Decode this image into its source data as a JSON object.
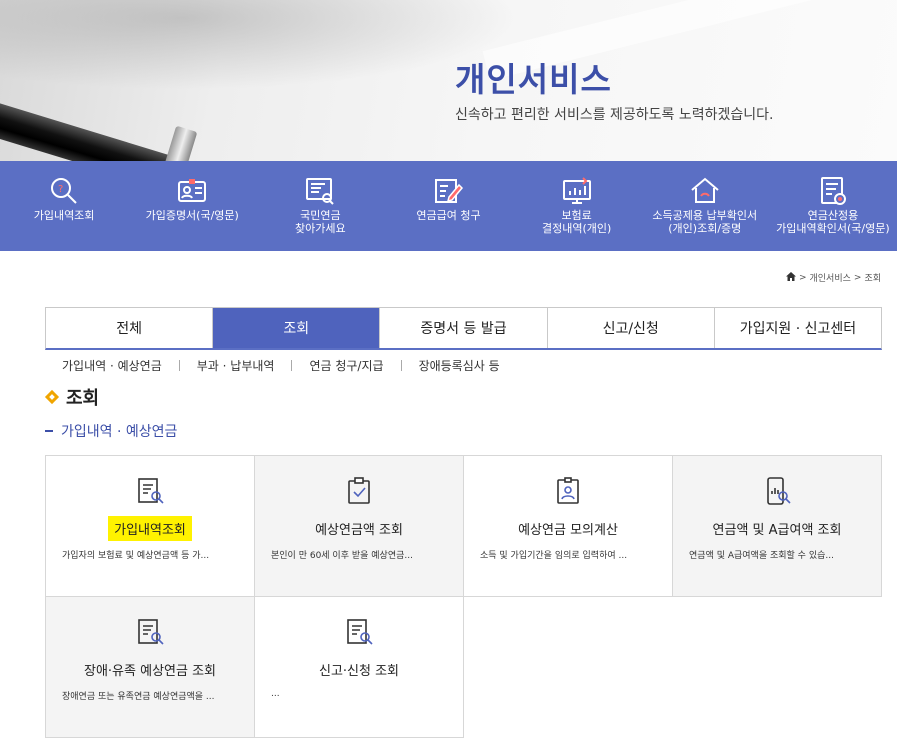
{
  "hero": {
    "title": "개인서비스",
    "subtitle": "신속하고 편리한 서비스를 제공하도록 노력하겠습니다."
  },
  "quick_menu": [
    {
      "label": "가입내역조회",
      "icon": "search-icon"
    },
    {
      "label": "가입증명서(국/영문)",
      "icon": "id-card-icon"
    },
    {
      "label": "국민연금\n찾아가세요",
      "icon": "document-search-icon"
    },
    {
      "label": "연금급여 청구",
      "icon": "edit-document-icon"
    },
    {
      "label": "보험료\n결정내역(개인)",
      "icon": "monitor-chart-icon"
    },
    {
      "label": "소득공제용 납부확인서\n(개인)조회/증명",
      "icon": "house-icon"
    },
    {
      "label": "연금산정용\n가입내역확인서(국/영문)",
      "icon": "document-stamp-icon"
    }
  ],
  "breadcrumb": {
    "home": "home-icon",
    "items": [
      "개인서비스",
      "조회"
    ]
  },
  "tabs": [
    "전체",
    "조회",
    "증명서 등 발급",
    "신고/신청",
    "가입지원 · 신고센터"
  ],
  "active_tab": "조회",
  "subtabs": [
    "가입내역 · 예상연금",
    "부과 · 납부내역",
    "연금 청구/지급",
    "장애등록심사 등"
  ],
  "section_title": "조회",
  "subsection_title": "가입내역 · 예상연금",
  "cards": [
    {
      "title": "가입내역조회",
      "desc": "가입자의 보험료 및 예상연금액 등 가...",
      "icon": "search-document-icon",
      "highlighted": true
    },
    {
      "title": "예상연금액 조회",
      "desc": "본인이 만 60세 이후 받을 예상연금...",
      "icon": "clipboard-check-icon"
    },
    {
      "title": "예상연금 모의계산",
      "desc": "소득 및 가입기간을 임의로 입력하여 ...",
      "icon": "person-document-icon"
    },
    {
      "title": "연금액 및 A급여액 조회",
      "desc": "연금액 및 A급여액을 조회할 수 있습...",
      "icon": "mobile-chart-icon"
    },
    {
      "title": "장애·유족 예상연금 조회",
      "desc": "장애연금 또는 유족연금 예상연금액을 ...",
      "icon": "search-document-icon"
    },
    {
      "title": "신고·신청 조회",
      "desc": "...",
      "icon": "search-document-icon"
    }
  ],
  "colors": {
    "primary": "#4f63bd",
    "iconbar": "#5b6fc4",
    "title": "#3c4fa8",
    "highlight": "#fff200",
    "accent": "#f0a500"
  }
}
